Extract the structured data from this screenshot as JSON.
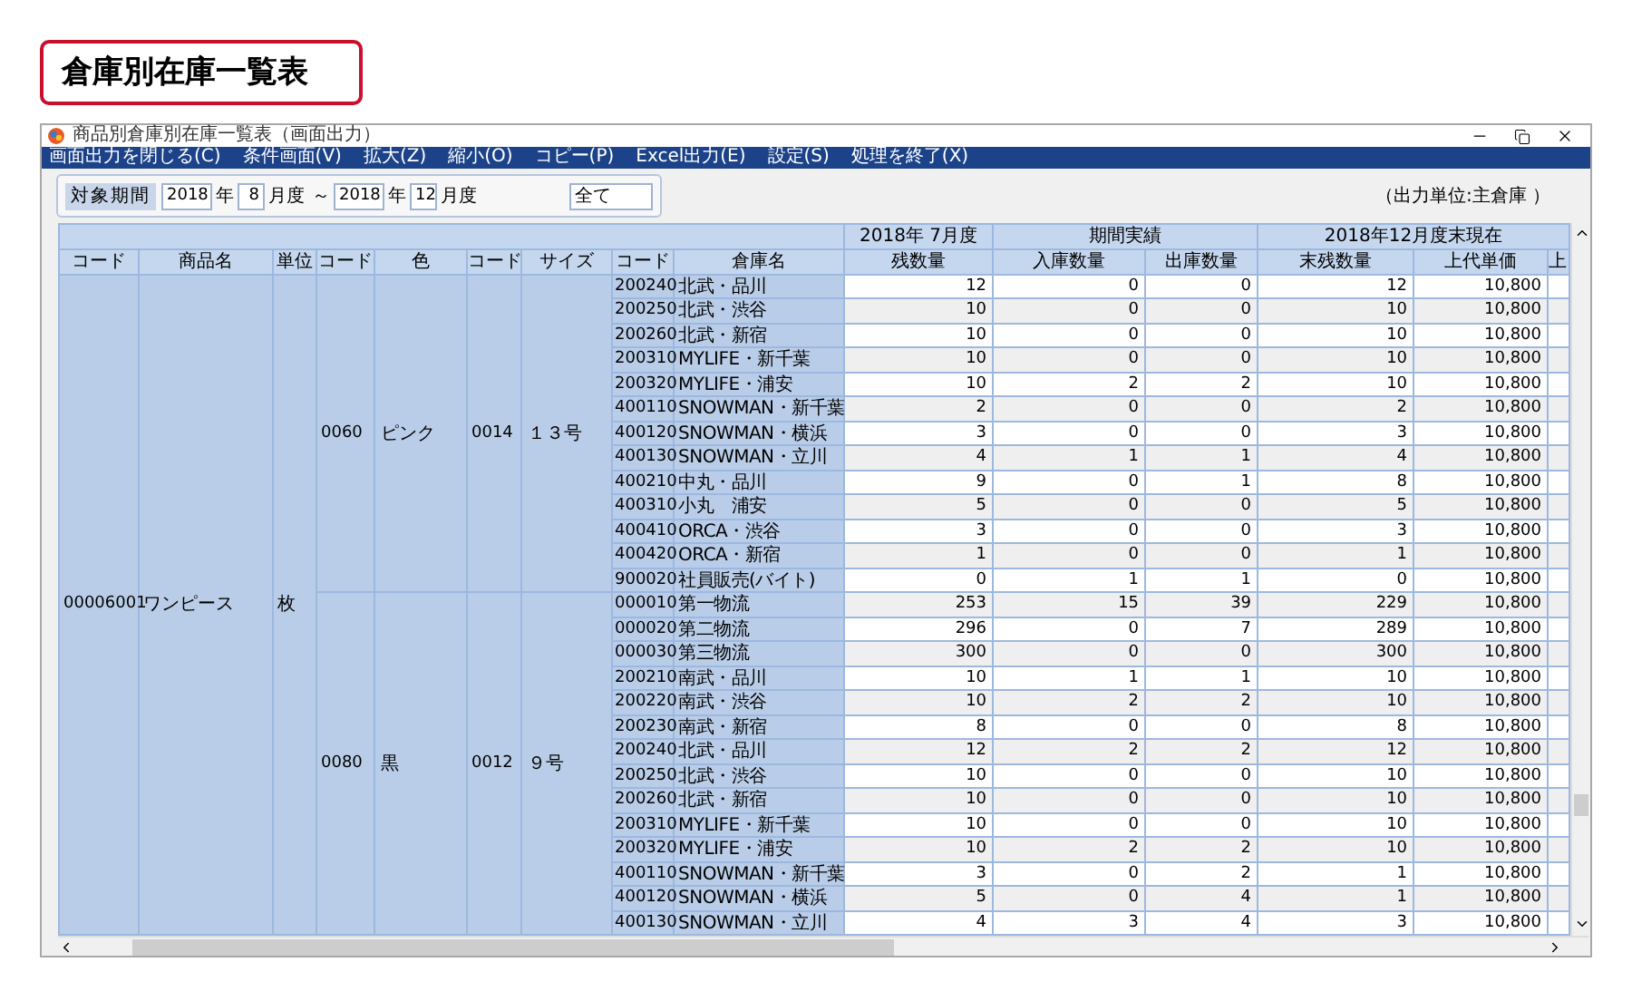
{
  "page_title": "倉庫別在庫一覧表",
  "window": {
    "title": "商品別倉庫別在庫一覧表（画面出力）"
  },
  "menu": [
    "画面出力を閉じる(C)",
    "条件画面(V)",
    "拡大(Z)",
    "縮小(O)",
    "コピー(P)",
    "Excel出力(E)",
    "設定(S)",
    "処理を終了(X)"
  ],
  "filter": {
    "label": "対象期間",
    "from_year": "2018",
    "from_year_unit": "年",
    "from_month": "8",
    "from_month_unit": "月度",
    "separator": "～",
    "to_year": "2018",
    "to_year_unit": "年",
    "to_month": "12",
    "to_month_unit": "月度",
    "scope": "全て"
  },
  "output_unit": "（出力単位:主倉庫 ）",
  "table": {
    "header_groups": [
      {
        "label": "2018年 7月度"
      },
      {
        "label": "期間実績"
      },
      {
        "label": "2018年12月度末現在"
      }
    ],
    "columns": [
      "コード",
      "商品名",
      "単位",
      "コード",
      "色",
      "コード",
      "サイズ",
      "コード",
      "倉庫名",
      "残数量",
      "入庫数量",
      "出庫数量",
      "末残数量",
      "上代単価",
      "上"
    ],
    "product": {
      "code": "00006001",
      "name": "ワンピース",
      "unit": "枚"
    },
    "groups": [
      {
        "color_code": "0060",
        "color_name": "ピンク",
        "size_code": "0014",
        "size": "１３号",
        "rows": [
          {
            "code": "200240",
            "warehouse": "北武・品川",
            "opening": "12",
            "in": "0",
            "out": "0",
            "closing": "12",
            "price": "10,800"
          },
          {
            "code": "200250",
            "warehouse": "北武・渋谷",
            "opening": "10",
            "in": "0",
            "out": "0",
            "closing": "10",
            "price": "10,800"
          },
          {
            "code": "200260",
            "warehouse": "北武・新宿",
            "opening": "10",
            "in": "0",
            "out": "0",
            "closing": "10",
            "price": "10,800"
          },
          {
            "code": "200310",
            "warehouse": "MYLIFE・新千葉",
            "opening": "10",
            "in": "0",
            "out": "0",
            "closing": "10",
            "price": "10,800"
          },
          {
            "code": "200320",
            "warehouse": "MYLIFE・浦安",
            "opening": "10",
            "in": "2",
            "out": "2",
            "closing": "10",
            "price": "10,800"
          },
          {
            "code": "400110",
            "warehouse": "SNOWMAN・新千葉",
            "opening": "2",
            "in": "0",
            "out": "0",
            "closing": "2",
            "price": "10,800"
          },
          {
            "code": "400120",
            "warehouse": "SNOWMAN・横浜",
            "opening": "3",
            "in": "0",
            "out": "0",
            "closing": "3",
            "price": "10,800"
          },
          {
            "code": "400130",
            "warehouse": "SNOWMAN・立川",
            "opening": "4",
            "in": "1",
            "out": "1",
            "closing": "4",
            "price": "10,800"
          },
          {
            "code": "400210",
            "warehouse": "中丸・品川",
            "opening": "9",
            "in": "0",
            "out": "1",
            "closing": "8",
            "price": "10,800"
          },
          {
            "code": "400310",
            "warehouse": "小丸　浦安",
            "opening": "5",
            "in": "0",
            "out": "0",
            "closing": "5",
            "price": "10,800"
          },
          {
            "code": "400410",
            "warehouse": "ORCA・渋谷",
            "opening": "3",
            "in": "0",
            "out": "0",
            "closing": "3",
            "price": "10,800"
          },
          {
            "code": "400420",
            "warehouse": "ORCA・新宿",
            "opening": "1",
            "in": "0",
            "out": "0",
            "closing": "1",
            "price": "10,800"
          },
          {
            "code": "900020",
            "warehouse": "社員販売(バイト)",
            "opening": "0",
            "in": "1",
            "out": "1",
            "closing": "0",
            "price": "10,800"
          }
        ]
      },
      {
        "color_code": "0080",
        "color_name": "黒",
        "size_code": "0012",
        "size": "９号",
        "rows": [
          {
            "code": "000010",
            "warehouse": "第一物流",
            "opening": "253",
            "in": "15",
            "out": "39",
            "closing": "229",
            "price": "10,800"
          },
          {
            "code": "000020",
            "warehouse": "第二物流",
            "opening": "296",
            "in": "0",
            "out": "7",
            "closing": "289",
            "price": "10,800"
          },
          {
            "code": "000030",
            "warehouse": "第三物流",
            "opening": "300",
            "in": "0",
            "out": "0",
            "closing": "300",
            "price": "10,800"
          },
          {
            "code": "200210",
            "warehouse": "南武・品川",
            "opening": "10",
            "in": "1",
            "out": "1",
            "closing": "10",
            "price": "10,800"
          },
          {
            "code": "200220",
            "warehouse": "南武・渋谷",
            "opening": "10",
            "in": "2",
            "out": "2",
            "closing": "10",
            "price": "10,800"
          },
          {
            "code": "200230",
            "warehouse": "南武・新宿",
            "opening": "8",
            "in": "0",
            "out": "0",
            "closing": "8",
            "price": "10,800"
          },
          {
            "code": "200240",
            "warehouse": "北武・品川",
            "opening": "12",
            "in": "2",
            "out": "2",
            "closing": "12",
            "price": "10,800"
          },
          {
            "code": "200250",
            "warehouse": "北武・渋谷",
            "opening": "10",
            "in": "0",
            "out": "0",
            "closing": "10",
            "price": "10,800"
          },
          {
            "code": "200260",
            "warehouse": "北武・新宿",
            "opening": "10",
            "in": "0",
            "out": "0",
            "closing": "10",
            "price": "10,800"
          },
          {
            "code": "200310",
            "warehouse": "MYLIFE・新千葉",
            "opening": "10",
            "in": "0",
            "out": "0",
            "closing": "10",
            "price": "10,800"
          },
          {
            "code": "200320",
            "warehouse": "MYLIFE・浦安",
            "opening": "10",
            "in": "2",
            "out": "2",
            "closing": "10",
            "price": "10,800"
          },
          {
            "code": "400110",
            "warehouse": "SNOWMAN・新千葉",
            "opening": "3",
            "in": "0",
            "out": "2",
            "closing": "1",
            "price": "10,800"
          },
          {
            "code": "400120",
            "warehouse": "SNOWMAN・横浜",
            "opening": "5",
            "in": "0",
            "out": "4",
            "closing": "1",
            "price": "10,800"
          },
          {
            "code": "400130",
            "warehouse": "SNOWMAN・立川",
            "opening": "4",
            "in": "3",
            "out": "4",
            "closing": "3",
            "price": "10,800"
          }
        ]
      }
    ]
  }
}
